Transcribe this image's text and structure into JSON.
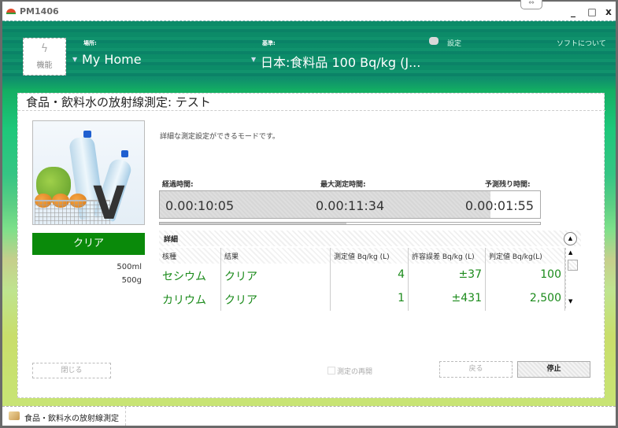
{
  "window": {
    "title": "PM1406",
    "controls": {
      "minimize": "_",
      "maximize": "□",
      "close": "x"
    },
    "snap_handle": "⇔"
  },
  "header": {
    "function_button": {
      "icon": "lightning-icon",
      "label": "機能"
    },
    "location": {
      "label": "場所:",
      "value": "My Home"
    },
    "standard": {
      "label": "基準:",
      "value": "日本:食料品 100 Bq/kg (J..."
    },
    "settings_link": "設定",
    "about_link": "ソフトについて"
  },
  "panel": {
    "title": "食品・飲料水の放射線測定: テスト",
    "description": "詳細な測定設定ができるモードです。",
    "status": {
      "label": "クリア",
      "color": "#0a8a0a"
    },
    "volume": "500ml",
    "weight": "500g",
    "timers": {
      "elapsed": {
        "label": "経過時間:",
        "value": "0.00:10:05"
      },
      "max": {
        "label": "最大測定時間:",
        "value": "0.00:11:34"
      },
      "remaining": {
        "label": "予測残り時間:",
        "value": "0.00:01:55"
      },
      "progress_percent": 87,
      "secondary_progress_percent": 49
    },
    "details": {
      "title": "詳細",
      "columns": [
        "核種",
        "結果",
        "測定値 Bq/kg (L)",
        "許容誤差 Bq/kg (L)",
        "判定値 Bq/kg(L)"
      ],
      "rows": [
        {
          "nuclide": "セシウム",
          "result": "クリア",
          "measured": "4",
          "tolerance": "±37",
          "threshold": "100"
        },
        {
          "nuclide": "カリウム",
          "result": "クリア",
          "measured": "1",
          "tolerance": "±431",
          "threshold": "2,500"
        }
      ]
    },
    "buttons": {
      "close": "閉じる",
      "resume": "測定の再開",
      "back": "戻る",
      "stop": "停止"
    }
  },
  "taskbar": {
    "tab_label": "食品・飲料水の放射線測定"
  }
}
